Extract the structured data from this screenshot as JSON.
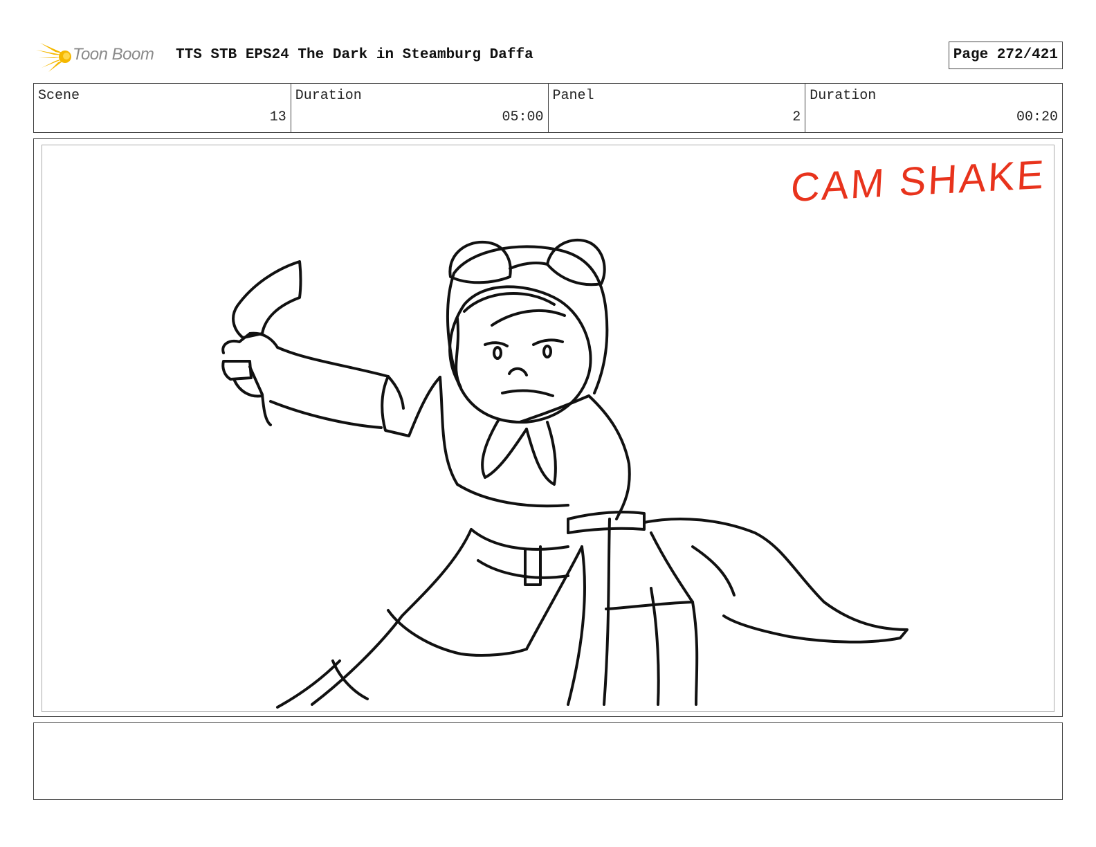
{
  "header": {
    "logo_text": "Toon Boom",
    "title": "TTS STB EPS24 The Dark in Steamburg Daffa",
    "page_label": "Page 272/421"
  },
  "info": {
    "scene_label": "Scene",
    "scene_value": "13",
    "scene_duration_label": "Duration",
    "scene_duration_value": "05:00",
    "panel_label": "Panel",
    "panel_value": "2",
    "panel_duration_label": "Duration",
    "panel_duration_value": "00:20"
  },
  "panel": {
    "drawing": "sketch-character-with-boomerang",
    "annotation": "CAM SHAKE",
    "annotation_color": "#e8331c"
  },
  "notes": {
    "text": ""
  },
  "colors": {
    "logo_accent": "#f5b800",
    "border": "#444444",
    "ink": "#111111"
  }
}
